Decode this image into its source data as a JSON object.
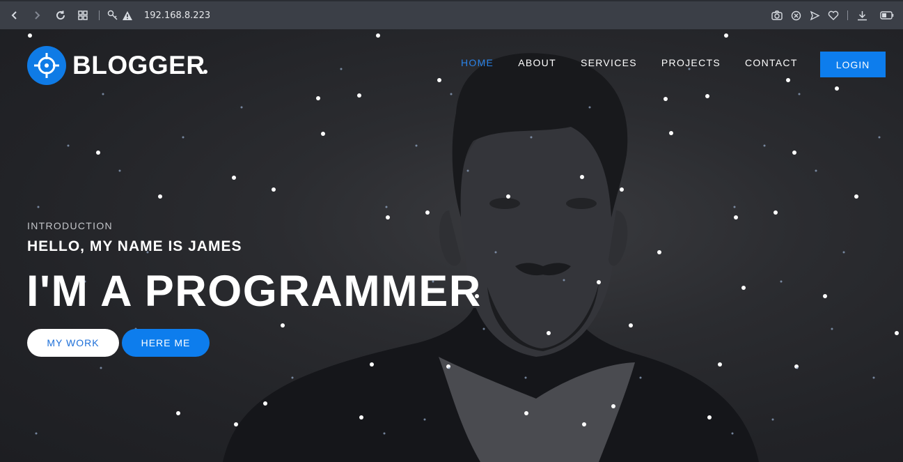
{
  "browser": {
    "url": "192.168.8.223",
    "icons": [
      "back-icon",
      "forward-icon",
      "reload-icon",
      "apps-grid-icon",
      "site-permissions-icon",
      "warning-icon",
      "camera-icon",
      "block-icon",
      "send-icon",
      "heart-icon",
      "download-icon",
      "battery-icon"
    ]
  },
  "site": {
    "brand": "BLOGGER",
    "nav": [
      {
        "label": "HOME",
        "active": true
      },
      {
        "label": "ABOUT",
        "active": false
      },
      {
        "label": "SERVICES",
        "active": false
      },
      {
        "label": "PROJECTS",
        "active": false
      },
      {
        "label": "CONTACT",
        "active": false
      }
    ],
    "login_label": "LOGIN"
  },
  "hero": {
    "eyebrow": "INTRODUCTION",
    "greeting": "HELLO, MY NAME IS JAMES",
    "headline": "I'M A PROGRAMMER",
    "work_button": "MY WORK",
    "hire_button": "HERE ME"
  },
  "colors": {
    "accent": "#0d7ded",
    "nav_active": "#2a83e8",
    "background": "#222327"
  }
}
